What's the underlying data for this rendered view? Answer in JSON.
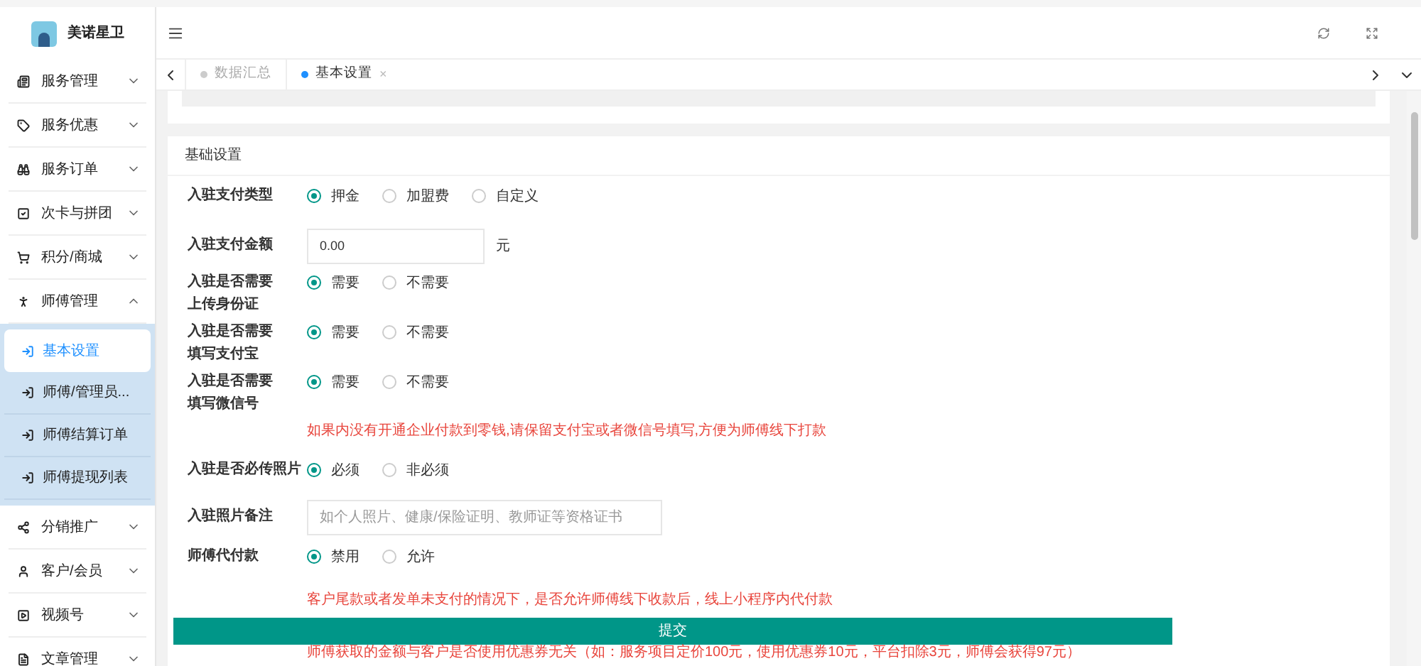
{
  "sidebar": {
    "logo_text": "美诺星卫",
    "items": [
      {
        "label": "服务管理",
        "expanded": false
      },
      {
        "label": "服务优惠",
        "expanded": false
      },
      {
        "label": "服务订单",
        "expanded": false
      },
      {
        "label": "次卡与拼团",
        "expanded": false
      },
      {
        "label": "积分/商城",
        "expanded": false
      },
      {
        "label": "师傅管理",
        "expanded": true,
        "children": [
          {
            "label": "基本设置",
            "selected": true
          },
          {
            "label": "师傅/管理员...",
            "selected": false
          },
          {
            "label": "师傅结算订单",
            "selected": false
          },
          {
            "label": "师傅提现列表",
            "selected": false
          }
        ]
      },
      {
        "label": "分销推广",
        "expanded": false
      },
      {
        "label": "客户/会员",
        "expanded": false
      },
      {
        "label": "视频号",
        "expanded": false
      },
      {
        "label": "文章管理",
        "expanded": false
      }
    ]
  },
  "tabs": [
    {
      "label": "数据汇总",
      "selected": false
    },
    {
      "label": "基本设置",
      "selected": true,
      "close": "×"
    }
  ],
  "card_title": "基础设置",
  "form": [
    {
      "kind": "radio",
      "label": [
        "入驻支付类型"
      ],
      "options": [
        {
          "label": "押金",
          "selected": true
        },
        {
          "label": "加盟费",
          "selected": false
        },
        {
          "label": "自定义",
          "selected": false
        }
      ]
    },
    {
      "kind": "amount",
      "label": [
        "入驻支付金额"
      ],
      "value": "0.00",
      "unit": "元"
    },
    {
      "kind": "radio",
      "label": [
        "入驻是否需要",
        "上传身份证"
      ],
      "options": [
        {
          "label": "需要",
          "selected": true
        },
        {
          "label": "不需要",
          "selected": false
        }
      ]
    },
    {
      "kind": "radio",
      "label": [
        "入驻是否需要",
        "填写支付宝"
      ],
      "options": [
        {
          "label": "需要",
          "selected": true
        },
        {
          "label": "不需要",
          "selected": false
        }
      ]
    },
    {
      "kind": "radio",
      "label": [
        "入驻是否需要",
        "填写微信号"
      ],
      "options": [
        {
          "label": "需要",
          "selected": true
        },
        {
          "label": "不需要",
          "selected": false
        }
      ]
    },
    {
      "kind": "note",
      "text": "如果内没有开通企业付款到零钱,请保留支付宝或者微信号填写,方便为师傅线下打款"
    },
    {
      "kind": "radio",
      "label": [
        "入驻是否必传照片"
      ],
      "options": [
        {
          "label": "必须",
          "selected": true
        },
        {
          "label": "非必须",
          "selected": false
        }
      ]
    },
    {
      "kind": "text",
      "label": [
        "入驻照片备注"
      ],
      "placeholder": "如个人照片、健康/保险证明、教师证等资格证书"
    },
    {
      "kind": "radio",
      "label": [
        "师傅代付款"
      ],
      "options": [
        {
          "label": "禁用",
          "selected": true
        },
        {
          "label": "允许",
          "selected": false
        }
      ]
    },
    {
      "kind": "note",
      "text": "客户尾款或者发单未支付的情况下，是否允许师傅线下收款后，线上小程序内代付款"
    }
  ],
  "submit": "提交",
  "footer_note": "师傅获取的金额与客户是否使用优惠券无关（如：服务项目定价100元，使用优惠券10元，平台扣除3元，师傅会获得97元）"
}
